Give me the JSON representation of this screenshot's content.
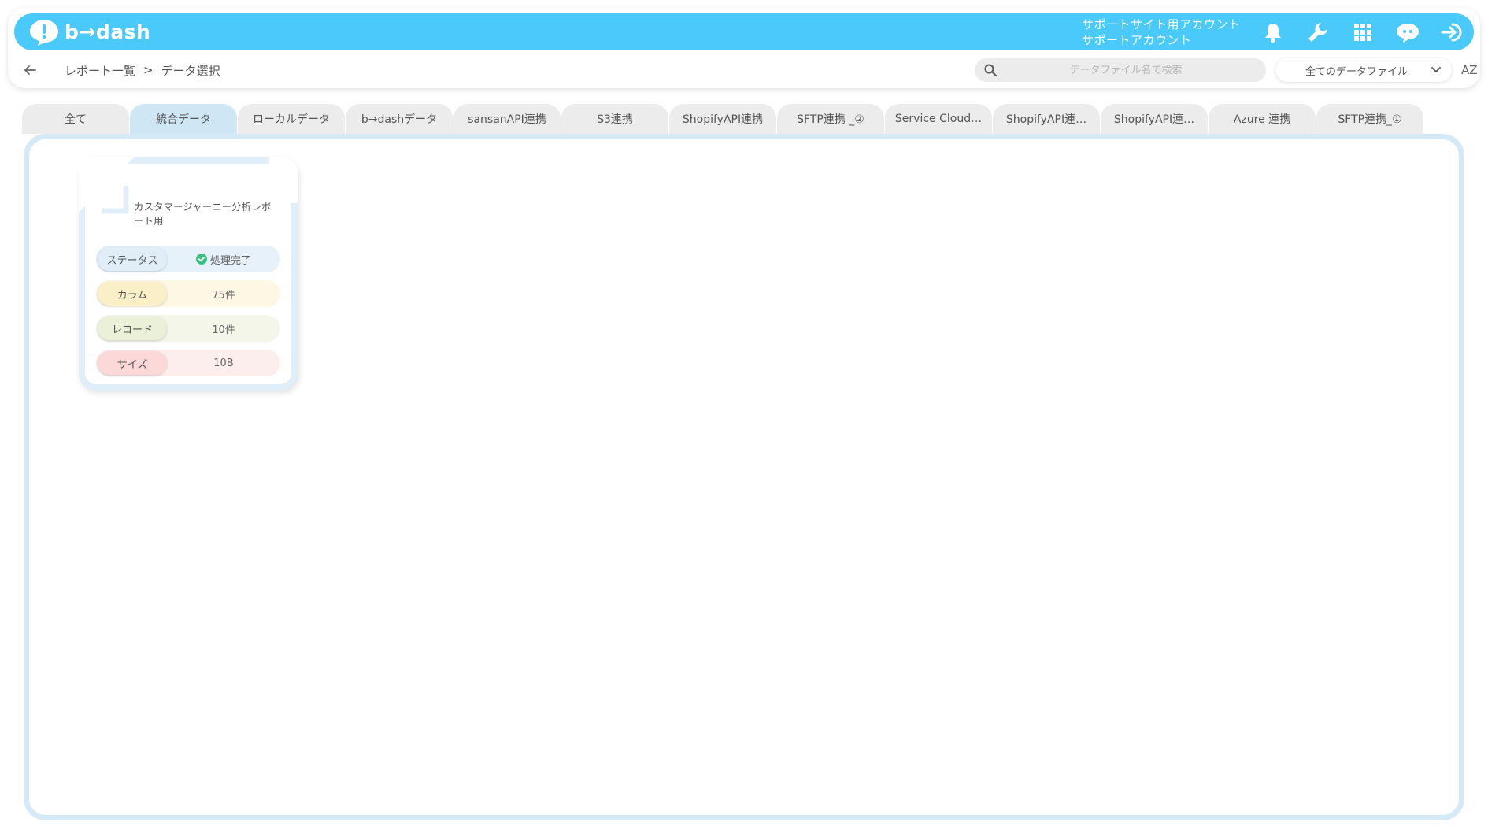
{
  "header": {
    "logo_text": "b→dash",
    "account_line1": "サポートサイト用アカウント",
    "account_line2": "サポートアカウント",
    "icons": [
      "bell-icon",
      "wrench-icon",
      "grid-icon",
      "chat-bot-icon",
      "logout-icon"
    ],
    "brand_color": "#4ac9fb"
  },
  "subbar": {
    "breadcrumb_parent": "レポート一覧",
    "breadcrumb_sep": ">",
    "breadcrumb_current": "データ選択",
    "search_placeholder": "データファイル名で検索",
    "filter_value": "全てのデータファイル",
    "sort_label": "AZ"
  },
  "tabs": [
    {
      "label": "全て",
      "active": false
    },
    {
      "label": "統合データ",
      "active": true
    },
    {
      "label": "ローカルデータ",
      "active": false
    },
    {
      "label": "b→dashデータ",
      "active": false
    },
    {
      "label": "sansanAPI連携",
      "active": false
    },
    {
      "label": "S3連携",
      "active": false
    },
    {
      "label": "ShopifyAPI連携",
      "active": false
    },
    {
      "label": "SFTP連携 _②",
      "active": false
    },
    {
      "label": "Service Cloud…",
      "active": false
    },
    {
      "label": "ShopifyAPI連…",
      "active": false
    },
    {
      "label": "ShopifyAPI連…",
      "active": false
    },
    {
      "label": "Azure 連携",
      "active": false
    },
    {
      "label": "SFTP連携_①",
      "active": false
    }
  ],
  "card": {
    "title": "カスタマージャーニー分析レポート用",
    "rows": {
      "status_label": "ステータス",
      "status_value": "処理完了",
      "column_label": "カラム",
      "column_value": "75件",
      "record_label": "レコード",
      "record_value": "10件",
      "size_label": "サイズ",
      "size_value": "10B"
    }
  }
}
